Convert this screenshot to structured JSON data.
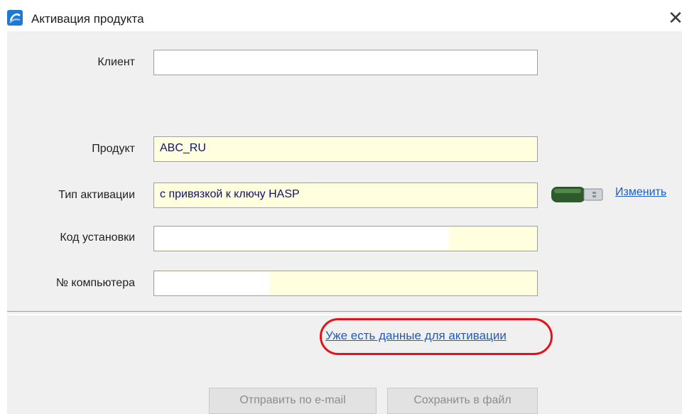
{
  "window": {
    "title": "Активация продукта",
    "icon": "app-icon",
    "close_icon": "close-icon",
    "close_glyph": "✕"
  },
  "form": {
    "client": {
      "label": "Клиент",
      "value": ""
    },
    "product": {
      "label": "Продукт",
      "value": "ABC_RU"
    },
    "activation_type": {
      "label": "Тип активации",
      "value": "с привязкой к ключу HASP"
    },
    "install_code": {
      "label": "Код установки",
      "value": ""
    },
    "computer_no": {
      "label": "№ компьютера",
      "value": ""
    }
  },
  "hasp": {
    "icon": "usb-key-icon",
    "change_label": "Изменить"
  },
  "links": {
    "already_have_data": "Уже есть данные для активации"
  },
  "buttons": {
    "send_email": "Отправить по e-mail",
    "save_file": "Сохранить в файл"
  },
  "colors": {
    "link": "#1a5cc8",
    "highlight": "#e3121b",
    "field_yellow": "#ffffe0",
    "panel": "#f0f0f0"
  }
}
